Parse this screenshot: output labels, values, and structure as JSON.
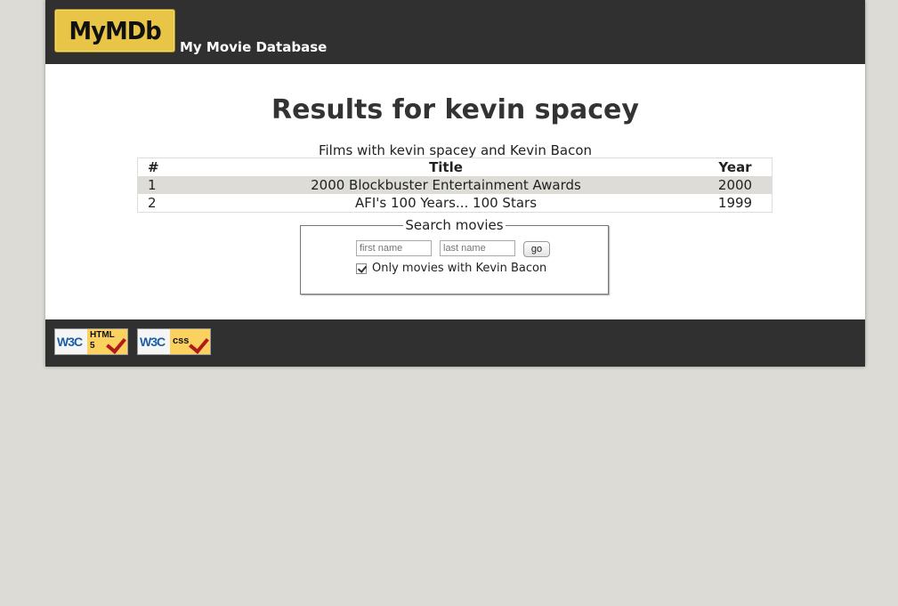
{
  "header": {
    "logo_text": "MyMDb",
    "tagline": "My Movie Database"
  },
  "main": {
    "title": "Results for kevin spacey",
    "table": {
      "caption": "Films with kevin spacey and Kevin Bacon",
      "headers": {
        "num": "#",
        "title": "Title",
        "year": "Year"
      },
      "rows": [
        {
          "num": "1",
          "title": "2000 Blockbuster Entertainment Awards",
          "year": "2000"
        },
        {
          "num": "2",
          "title": "AFI's 100 Years... 100 Stars",
          "year": "1999"
        }
      ]
    }
  },
  "search": {
    "legend": "Search movies",
    "first_name_placeholder": "first name",
    "last_name_placeholder": "last name",
    "go_label": "go",
    "checkbox_label": "Only movies with Kevin Bacon",
    "checkbox_checked": true
  },
  "footer": {
    "badges": [
      {
        "w3c": "W3C",
        "line1": "HTML",
        "line2": "5"
      },
      {
        "w3c": "W3C",
        "line1": "css"
      }
    ]
  },
  "colors": {
    "banner": "#303030",
    "logo": "#e8c447",
    "page_background": "#dcdbd6",
    "row_highlight": "#dddcd6"
  }
}
